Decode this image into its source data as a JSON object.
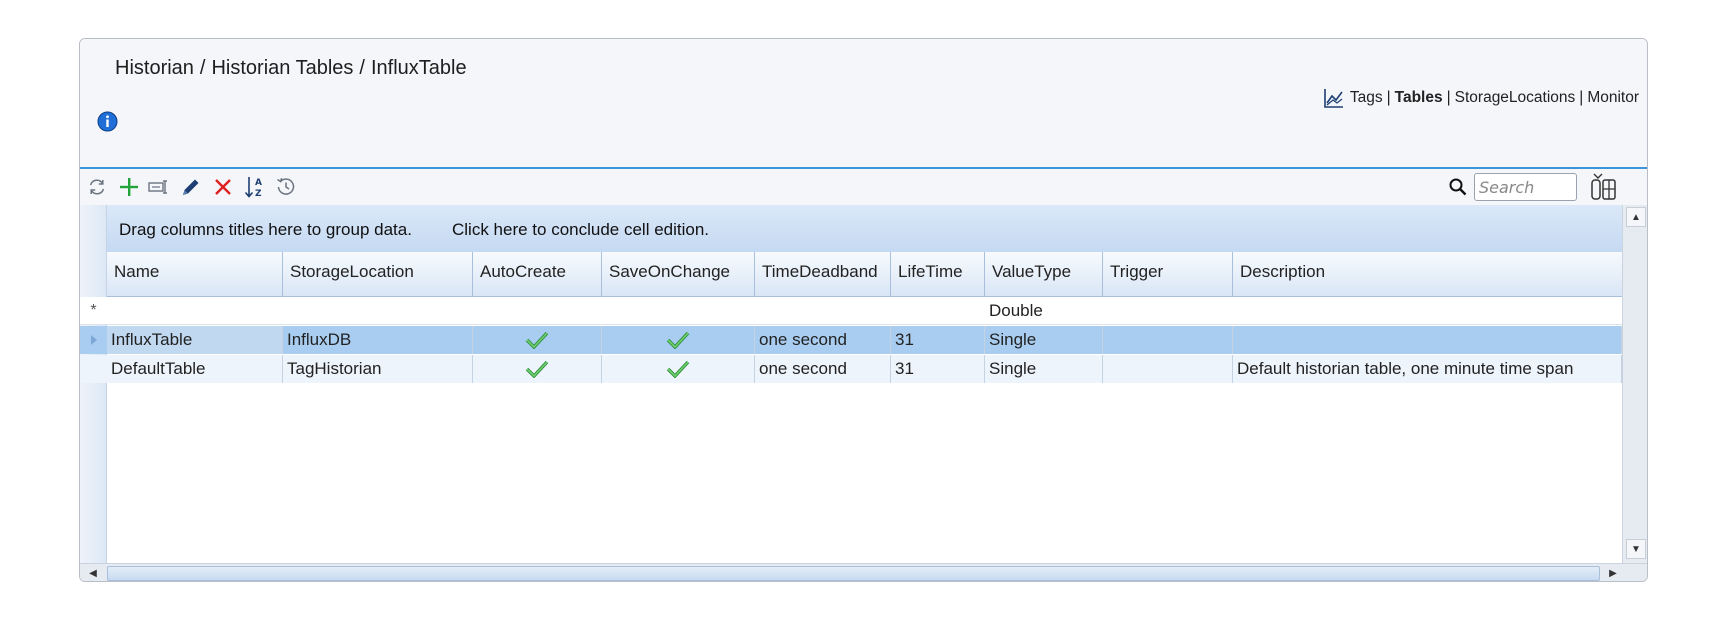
{
  "breadcrumb": [
    "Historian",
    "Historian Tables",
    "InfluxTable"
  ],
  "breadcrumb_sep": "/",
  "nav": {
    "tags": "Tags",
    "tables": "Tables",
    "storage": "StorageLocations",
    "monitor": "Monitor",
    "sep": "|"
  },
  "toolbar": {
    "buttons": [
      "refresh-icon",
      "plus-icon",
      "rename-icon",
      "pencil-icon",
      "close-icon",
      "sort-az-icon",
      "history-icon"
    ]
  },
  "search": {
    "placeholder": "Search",
    "value": ""
  },
  "grid": {
    "group_hint": "Drag columns titles here to group data.",
    "conclude_edit": "Click here to conclude cell edition.",
    "columns": [
      "Name",
      "StorageLocation",
      "AutoCreate",
      "SaveOnChange",
      "TimeDeadband",
      "LifeTime",
      "ValueType",
      "Trigger",
      "Description"
    ],
    "new_row": {
      "marker": "*",
      "value_type": "Double"
    },
    "rows": [
      {
        "name": "InfluxTable",
        "storage": "InfluxDB",
        "auto_create": true,
        "save_on_change": true,
        "deadband": "one second",
        "lifetime": "31",
        "value_type": "Single",
        "trigger": "",
        "description": ""
      },
      {
        "name": "DefaultTable",
        "storage": "TagHistorian",
        "auto_create": true,
        "save_on_change": true,
        "deadband": "one second",
        "lifetime": "31",
        "value_type": "Single",
        "trigger": "",
        "description": "Default historian table, one minute time span"
      }
    ]
  },
  "colors": {
    "accent": "#3b94d9",
    "selected_row": "#a8cdf0",
    "check_green": "#4caf50",
    "delete_red": "#e02020",
    "add_green": "#22a33a",
    "info_blue": "#1f6fd6"
  }
}
